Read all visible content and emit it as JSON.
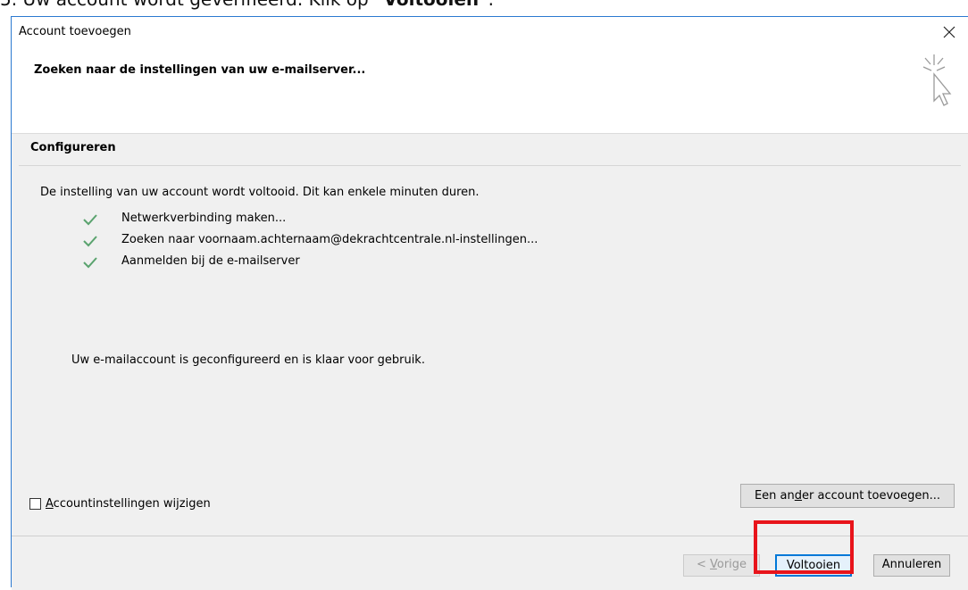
{
  "caption": {
    "text_prefix": "5. Uw account wordt geverifieerd. Klik op ",
    "text_bold": "\"Voltooien\"",
    "text_suffix": "."
  },
  "window": {
    "title": "Account toevoegen",
    "close_glyph": "×"
  },
  "header": {
    "title": "Zoeken naar de instellingen van uw e-mailserver...",
    "icon": "cursor-sparkle-icon"
  },
  "configure": {
    "section_title": "Configureren",
    "intro": "De instelling van uw account wordt voltooid. Dit kan enkele minuten duren.",
    "steps": [
      {
        "label": "Netwerkverbinding maken...",
        "status": "done"
      },
      {
        "label": "Zoeken naar voornaam.achternaam@dekrachtcentrale.nl-instellingen...",
        "status": "done"
      },
      {
        "label": "Aanmelden bij de e-mailserver",
        "status": "done"
      }
    ],
    "done_message": "Uw e-mailaccount is geconfigureerd en is klaar voor gebruik.",
    "checkbox_label_underlined": "A",
    "checkbox_label_rest": "ccountinstellingen wijzigen",
    "checkbox_checked": false,
    "add_other_pre": "Een an",
    "add_other_underlined": "d",
    "add_other_post": "er account toevoegen..."
  },
  "footer": {
    "prev_pre": "< ",
    "prev_underlined": "V",
    "prev_post": "orige",
    "finish_label": "Voltooien",
    "cancel_label": "Annuleren"
  },
  "colors": {
    "check_green": "#5aa36e",
    "highlight_red": "#e8141b",
    "accent_blue": "#0078d7"
  }
}
